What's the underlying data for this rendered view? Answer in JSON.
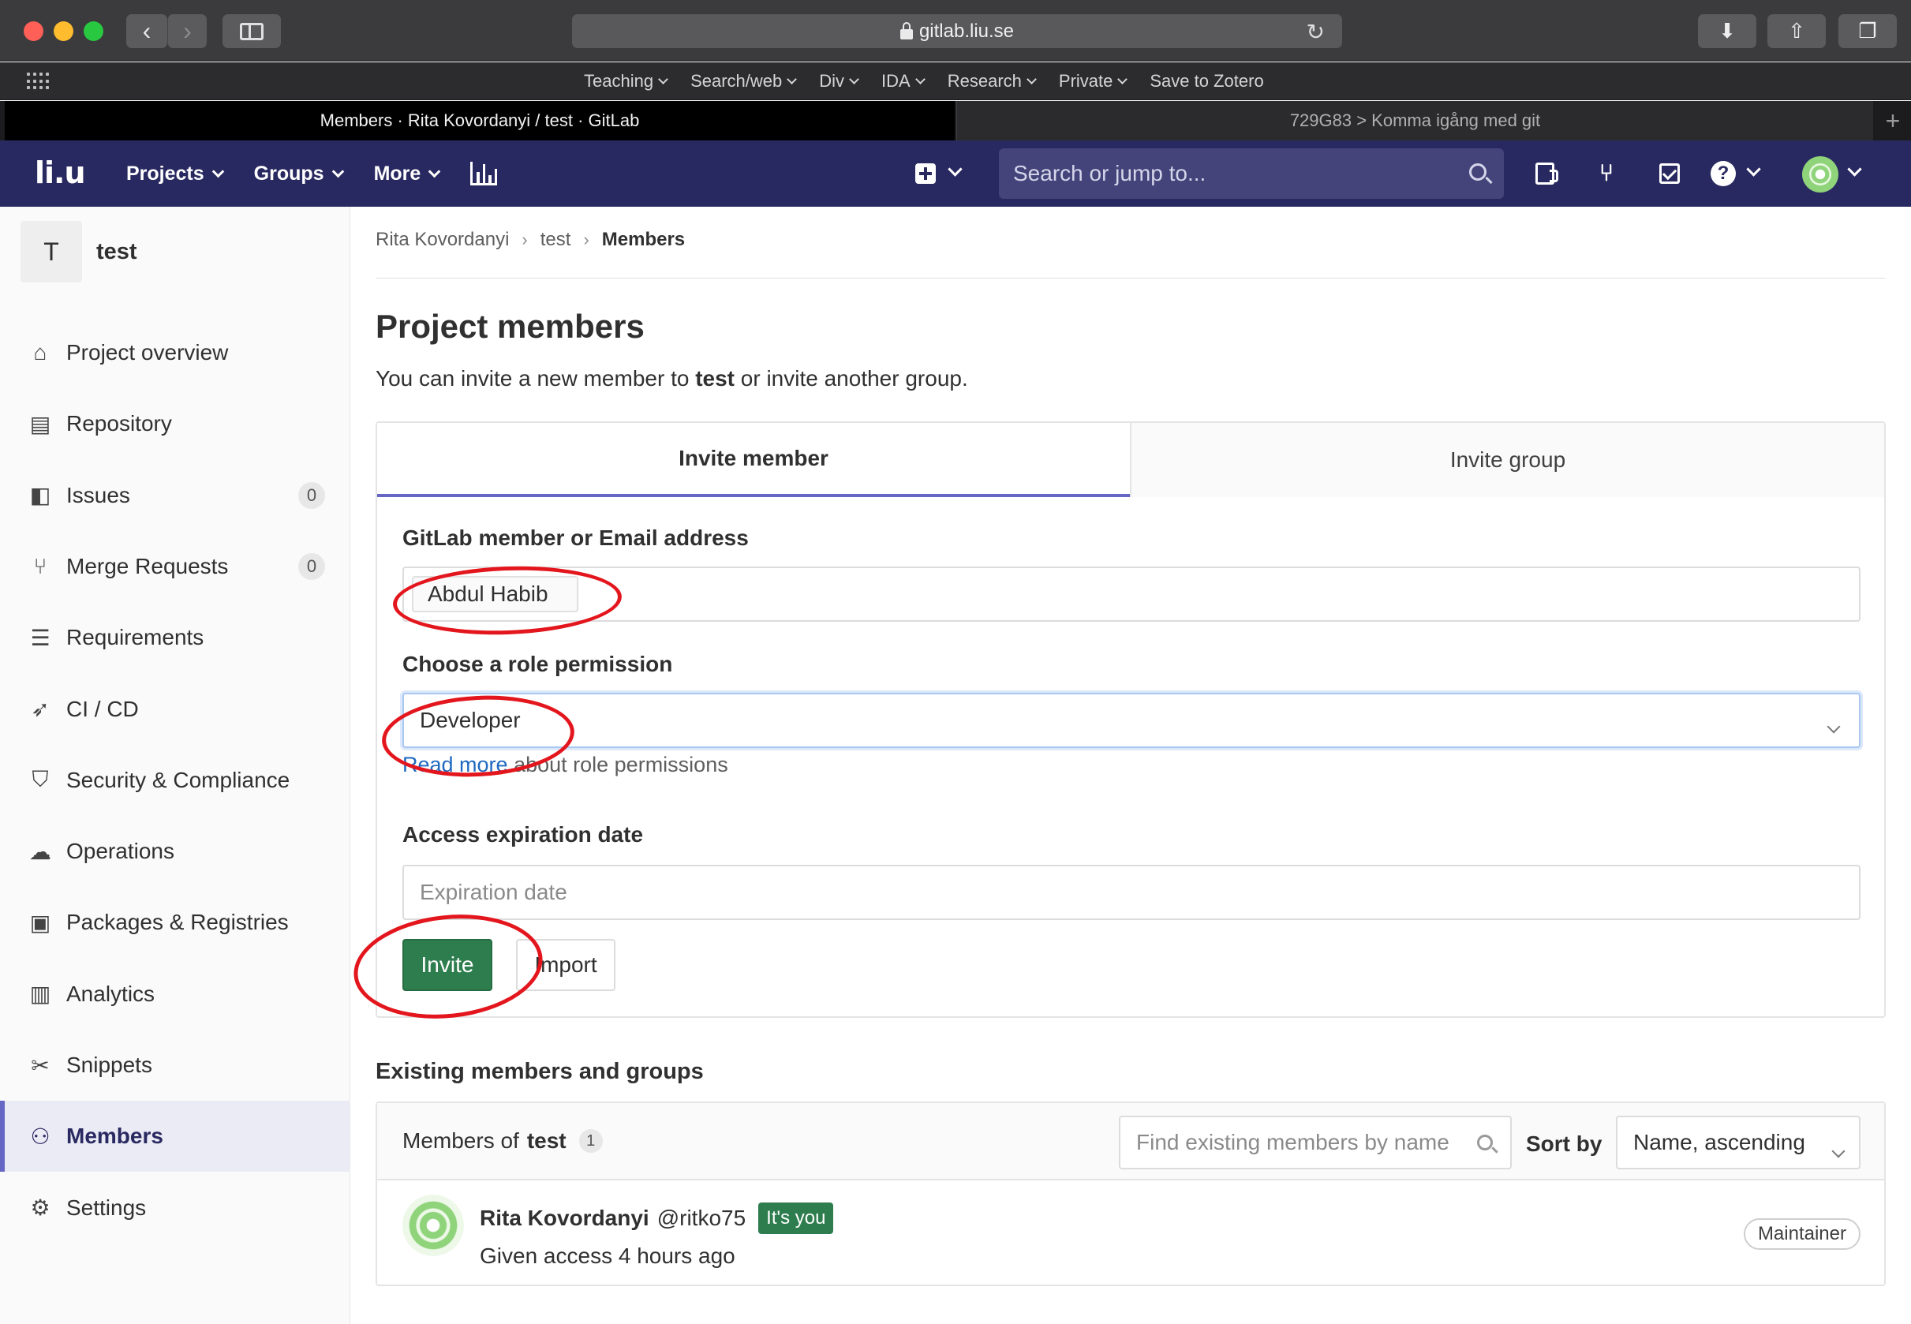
{
  "browser": {
    "url": "gitlab.liu.se",
    "favorites": [
      "Teaching",
      "Search/web",
      "Div",
      "IDA",
      "Research",
      "Private",
      "Save to Zotero"
    ],
    "tabs": [
      {
        "label": "Members · Rita Kovordanyi / test · GitLab",
        "active": true
      },
      {
        "label": "729G83 > Komma igång med git",
        "active": false
      }
    ]
  },
  "topnav": {
    "logo": "li.u",
    "menus": [
      "Projects",
      "Groups",
      "More"
    ],
    "search_placeholder": "Search or jump to..."
  },
  "sidebar": {
    "project_initial": "T",
    "project_name": "test",
    "items": [
      {
        "label": "Project overview",
        "icon": "home-icon"
      },
      {
        "label": "Repository",
        "icon": "doc-icon"
      },
      {
        "label": "Issues",
        "icon": "issues-icon",
        "count": "0"
      },
      {
        "label": "Merge Requests",
        "icon": "merge-request-icon",
        "count": "0"
      },
      {
        "label": "Requirements",
        "icon": "requirements-icon"
      },
      {
        "label": "CI / CD",
        "icon": "rocket-icon"
      },
      {
        "label": "Security & Compliance",
        "icon": "shield-icon"
      },
      {
        "label": "Operations",
        "icon": "cloud-gear-icon"
      },
      {
        "label": "Packages & Registries",
        "icon": "package-icon"
      },
      {
        "label": "Analytics",
        "icon": "chart-icon"
      },
      {
        "label": "Snippets",
        "icon": "scissors-icon"
      },
      {
        "label": "Members",
        "icon": "users-icon",
        "active": true
      },
      {
        "label": "Settings",
        "icon": "gear-icon"
      }
    ]
  },
  "breadcrumb": [
    "Rita Kovordanyi",
    "test",
    "Members"
  ],
  "page": {
    "title": "Project members",
    "desc_pre": "You can invite a new member to ",
    "desc_bold": "test",
    "desc_post": " or invite another group."
  },
  "invite": {
    "tabs": [
      "Invite member",
      "Invite group"
    ],
    "member_label": "GitLab member or Email address",
    "member_value": "Abdul Habib",
    "role_label": "Choose a role permission",
    "role_value": "Developer",
    "read_more_link": "Read more",
    "read_more_rest": " about role permissions",
    "expiry_label": "Access expiration date",
    "expiry_placeholder": "Expiration date",
    "invite_button": "Invite",
    "import_button": "Import"
  },
  "existing": {
    "section_title": "Existing members and groups",
    "members_of_prefix": "Members of ",
    "members_of_name": "test",
    "members_count": "1",
    "find_placeholder": "Find existing members by name",
    "sort_label": "Sort by",
    "sort_value": "Name, ascending",
    "members": [
      {
        "name": "Rita Kovordanyi",
        "username": "@ritko75",
        "badge": "It's you",
        "access": "Given access 4 hours ago",
        "role": "Maintainer"
      }
    ]
  }
}
